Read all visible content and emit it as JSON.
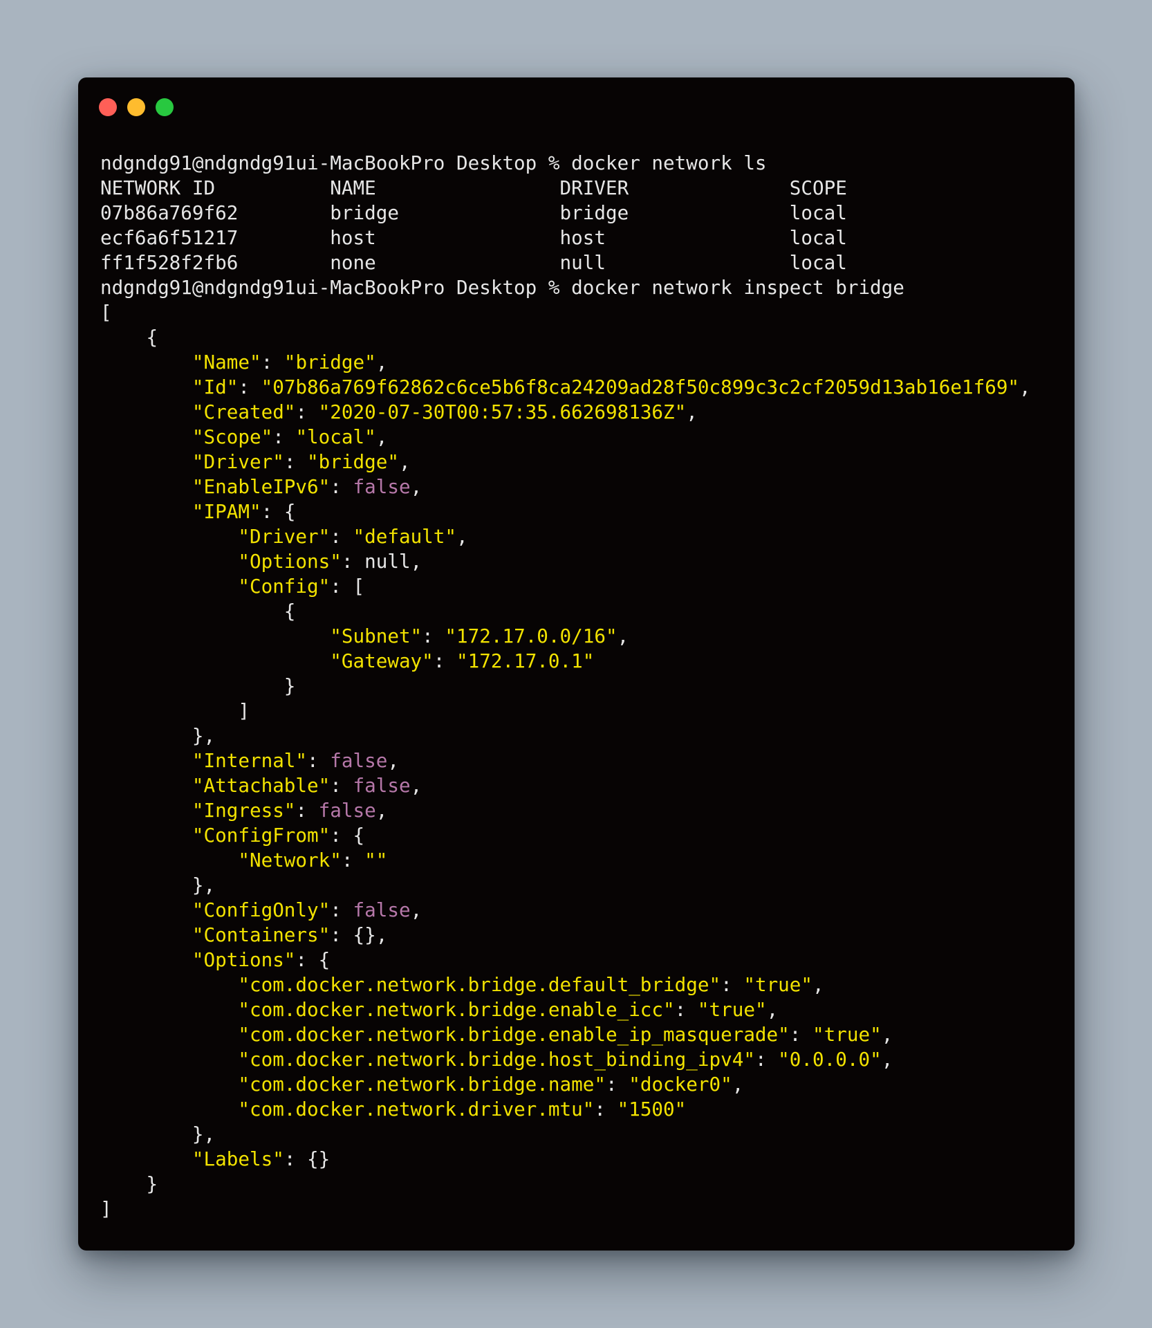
{
  "colors": {
    "page_background": "#a9b4bf",
    "terminal_background": "#070404",
    "default_text": "#e6e6e6",
    "json_string": "#f2e200",
    "json_boolean": "#b678a9",
    "window_close": "#ff5f57",
    "window_minimize": "#febc2e",
    "window_zoom": "#28c840"
  },
  "window_buttons": [
    {
      "name": "close",
      "color": "#ff5f57"
    },
    {
      "name": "minimize",
      "color": "#febc2e"
    },
    {
      "name": "zoom",
      "color": "#28c840"
    }
  ],
  "terminal": {
    "lines": [
      [
        {
          "t": "ndgndg91@ndgndg91ui-MacBookPro Desktop % docker network ls",
          "k": "p"
        }
      ],
      [
        {
          "t": "NETWORK ID          NAME                DRIVER              SCOPE",
          "k": "p"
        }
      ],
      [
        {
          "t": "07b86a769f62        bridge              bridge              local",
          "k": "p"
        }
      ],
      [
        {
          "t": "ecf6a6f51217        host                host                local",
          "k": "p"
        }
      ],
      [
        {
          "t": "ff1f528f2fb6        none                null                local",
          "k": "p"
        }
      ],
      [
        {
          "t": "ndgndg91@ndgndg91ui-MacBookPro Desktop % docker network inspect bridge",
          "k": "p"
        }
      ],
      [
        {
          "t": "[",
          "k": "p"
        }
      ],
      [
        {
          "t": "    {",
          "k": "p"
        }
      ],
      [
        {
          "t": "        ",
          "k": "p"
        },
        {
          "t": "\"Name\"",
          "k": "s"
        },
        {
          "t": ": ",
          "k": "p"
        },
        {
          "t": "\"bridge\"",
          "k": "s"
        },
        {
          "t": ",",
          "k": "p"
        }
      ],
      [
        {
          "t": "        ",
          "k": "p"
        },
        {
          "t": "\"Id\"",
          "k": "s"
        },
        {
          "t": ": ",
          "k": "p"
        },
        {
          "t": "\"07b86a769f62862c6ce5b6f8ca24209ad28f50c899c3c2cf2059d13ab16e1f69\"",
          "k": "s"
        },
        {
          "t": ",",
          "k": "p"
        }
      ],
      [
        {
          "t": "        ",
          "k": "p"
        },
        {
          "t": "\"Created\"",
          "k": "s"
        },
        {
          "t": ": ",
          "k": "p"
        },
        {
          "t": "\"2020-07-30T00:57:35.662698136Z\"",
          "k": "s"
        },
        {
          "t": ",",
          "k": "p"
        }
      ],
      [
        {
          "t": "        ",
          "k": "p"
        },
        {
          "t": "\"Scope\"",
          "k": "s"
        },
        {
          "t": ": ",
          "k": "p"
        },
        {
          "t": "\"local\"",
          "k": "s"
        },
        {
          "t": ",",
          "k": "p"
        }
      ],
      [
        {
          "t": "        ",
          "k": "p"
        },
        {
          "t": "\"Driver\"",
          "k": "s"
        },
        {
          "t": ": ",
          "k": "p"
        },
        {
          "t": "\"bridge\"",
          "k": "s"
        },
        {
          "t": ",",
          "k": "p"
        }
      ],
      [
        {
          "t": "        ",
          "k": "p"
        },
        {
          "t": "\"EnableIPv6\"",
          "k": "s"
        },
        {
          "t": ": ",
          "k": "p"
        },
        {
          "t": "false",
          "k": "b"
        },
        {
          "t": ",",
          "k": "p"
        }
      ],
      [
        {
          "t": "        ",
          "k": "p"
        },
        {
          "t": "\"IPAM\"",
          "k": "s"
        },
        {
          "t": ": {",
          "k": "p"
        }
      ],
      [
        {
          "t": "            ",
          "k": "p"
        },
        {
          "t": "\"Driver\"",
          "k": "s"
        },
        {
          "t": ": ",
          "k": "p"
        },
        {
          "t": "\"default\"",
          "k": "s"
        },
        {
          "t": ",",
          "k": "p"
        }
      ],
      [
        {
          "t": "            ",
          "k": "p"
        },
        {
          "t": "\"Options\"",
          "k": "s"
        },
        {
          "t": ": null,",
          "k": "p"
        }
      ],
      [
        {
          "t": "            ",
          "k": "p"
        },
        {
          "t": "\"Config\"",
          "k": "s"
        },
        {
          "t": ": [",
          "k": "p"
        }
      ],
      [
        {
          "t": "                {",
          "k": "p"
        }
      ],
      [
        {
          "t": "                    ",
          "k": "p"
        },
        {
          "t": "\"Subnet\"",
          "k": "s"
        },
        {
          "t": ": ",
          "k": "p"
        },
        {
          "t": "\"172.17.0.0/16\"",
          "k": "s"
        },
        {
          "t": ",",
          "k": "p"
        }
      ],
      [
        {
          "t": "                    ",
          "k": "p"
        },
        {
          "t": "\"Gateway\"",
          "k": "s"
        },
        {
          "t": ": ",
          "k": "p"
        },
        {
          "t": "\"172.17.0.1\"",
          "k": "s"
        }
      ],
      [
        {
          "t": "                }",
          "k": "p"
        }
      ],
      [
        {
          "t": "            ]",
          "k": "p"
        }
      ],
      [
        {
          "t": "        },",
          "k": "p"
        }
      ],
      [
        {
          "t": "        ",
          "k": "p"
        },
        {
          "t": "\"Internal\"",
          "k": "s"
        },
        {
          "t": ": ",
          "k": "p"
        },
        {
          "t": "false",
          "k": "b"
        },
        {
          "t": ",",
          "k": "p"
        }
      ],
      [
        {
          "t": "        ",
          "k": "p"
        },
        {
          "t": "\"Attachable\"",
          "k": "s"
        },
        {
          "t": ": ",
          "k": "p"
        },
        {
          "t": "false",
          "k": "b"
        },
        {
          "t": ",",
          "k": "p"
        }
      ],
      [
        {
          "t": "        ",
          "k": "p"
        },
        {
          "t": "\"Ingress\"",
          "k": "s"
        },
        {
          "t": ": ",
          "k": "p"
        },
        {
          "t": "false",
          "k": "b"
        },
        {
          "t": ",",
          "k": "p"
        }
      ],
      [
        {
          "t": "        ",
          "k": "p"
        },
        {
          "t": "\"ConfigFrom\"",
          "k": "s"
        },
        {
          "t": ": {",
          "k": "p"
        }
      ],
      [
        {
          "t": "            ",
          "k": "p"
        },
        {
          "t": "\"Network\"",
          "k": "s"
        },
        {
          "t": ": ",
          "k": "p"
        },
        {
          "t": "\"\"",
          "k": "s"
        }
      ],
      [
        {
          "t": "        },",
          "k": "p"
        }
      ],
      [
        {
          "t": "        ",
          "k": "p"
        },
        {
          "t": "\"ConfigOnly\"",
          "k": "s"
        },
        {
          "t": ": ",
          "k": "p"
        },
        {
          "t": "false",
          "k": "b"
        },
        {
          "t": ",",
          "k": "p"
        }
      ],
      [
        {
          "t": "        ",
          "k": "p"
        },
        {
          "t": "\"Containers\"",
          "k": "s"
        },
        {
          "t": ": {},",
          "k": "p"
        }
      ],
      [
        {
          "t": "        ",
          "k": "p"
        },
        {
          "t": "\"Options\"",
          "k": "s"
        },
        {
          "t": ": {",
          "k": "p"
        }
      ],
      [
        {
          "t": "            ",
          "k": "p"
        },
        {
          "t": "\"com.docker.network.bridge.default_bridge\"",
          "k": "s"
        },
        {
          "t": ": ",
          "k": "p"
        },
        {
          "t": "\"true\"",
          "k": "s"
        },
        {
          "t": ",",
          "k": "p"
        }
      ],
      [
        {
          "t": "            ",
          "k": "p"
        },
        {
          "t": "\"com.docker.network.bridge.enable_icc\"",
          "k": "s"
        },
        {
          "t": ": ",
          "k": "p"
        },
        {
          "t": "\"true\"",
          "k": "s"
        },
        {
          "t": ",",
          "k": "p"
        }
      ],
      [
        {
          "t": "            ",
          "k": "p"
        },
        {
          "t": "\"com.docker.network.bridge.enable_ip_masquerade\"",
          "k": "s"
        },
        {
          "t": ": ",
          "k": "p"
        },
        {
          "t": "\"true\"",
          "k": "s"
        },
        {
          "t": ",",
          "k": "p"
        }
      ],
      [
        {
          "t": "            ",
          "k": "p"
        },
        {
          "t": "\"com.docker.network.bridge.host_binding_ipv4\"",
          "k": "s"
        },
        {
          "t": ": ",
          "k": "p"
        },
        {
          "t": "\"0.0.0.0\"",
          "k": "s"
        },
        {
          "t": ",",
          "k": "p"
        }
      ],
      [
        {
          "t": "            ",
          "k": "p"
        },
        {
          "t": "\"com.docker.network.bridge.name\"",
          "k": "s"
        },
        {
          "t": ": ",
          "k": "p"
        },
        {
          "t": "\"docker0\"",
          "k": "s"
        },
        {
          "t": ",",
          "k": "p"
        }
      ],
      [
        {
          "t": "            ",
          "k": "p"
        },
        {
          "t": "\"com.docker.network.driver.mtu\"",
          "k": "s"
        },
        {
          "t": ": ",
          "k": "p"
        },
        {
          "t": "\"1500\"",
          "k": "s"
        }
      ],
      [
        {
          "t": "        },",
          "k": "p"
        }
      ],
      [
        {
          "t": "        ",
          "k": "p"
        },
        {
          "t": "\"Labels\"",
          "k": "s"
        },
        {
          "t": ": {}",
          "k": "p"
        }
      ],
      [
        {
          "t": "    }",
          "k": "p"
        }
      ],
      [
        {
          "t": "]",
          "k": "p"
        }
      ]
    ]
  }
}
